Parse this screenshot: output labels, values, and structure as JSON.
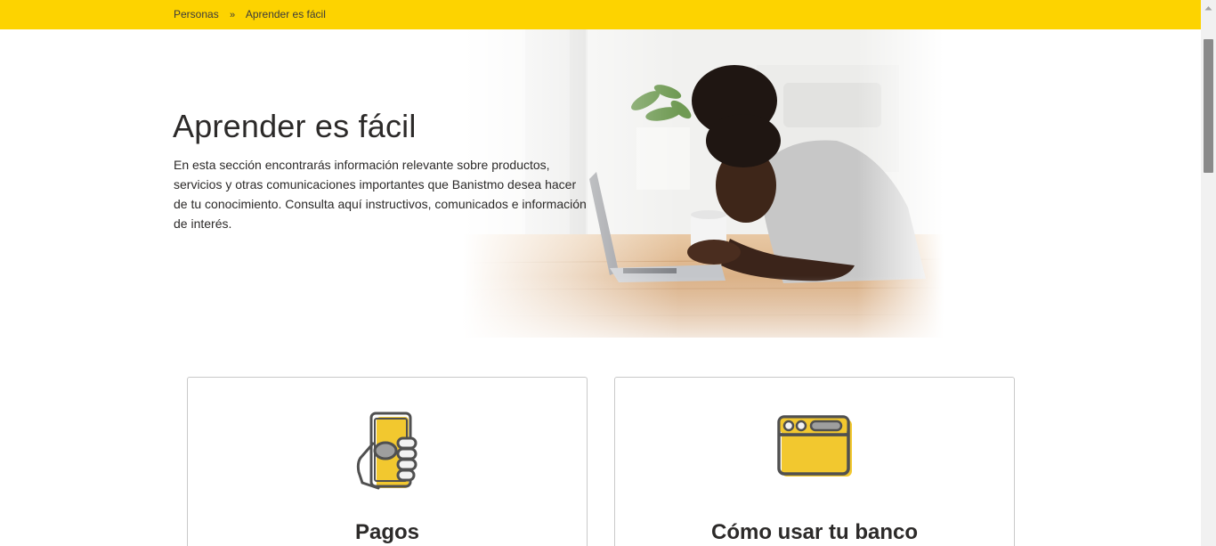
{
  "breadcrumb": {
    "items": [
      {
        "label": "Personas"
      },
      {
        "label": "Aprender es fácil"
      }
    ],
    "separator": "»"
  },
  "hero": {
    "title": "Aprender es fácil",
    "description": "En esta sección encontrarás información relevante sobre productos, servicios y otras comunicaciones importantes que Banistmo desea hacer de tu conocimiento. Consulta aquí instructivos, comunicados e información de interés."
  },
  "cards": [
    {
      "title": "Pagos",
      "icon": "hand-phone-icon"
    },
    {
      "title": "Cómo usar tu banco",
      "icon": "browser-window-icon"
    }
  ],
  "colors": {
    "brand_yellow": "#fdd300",
    "icon_yellow": "#f2c82f",
    "text": "#2c2a29"
  }
}
